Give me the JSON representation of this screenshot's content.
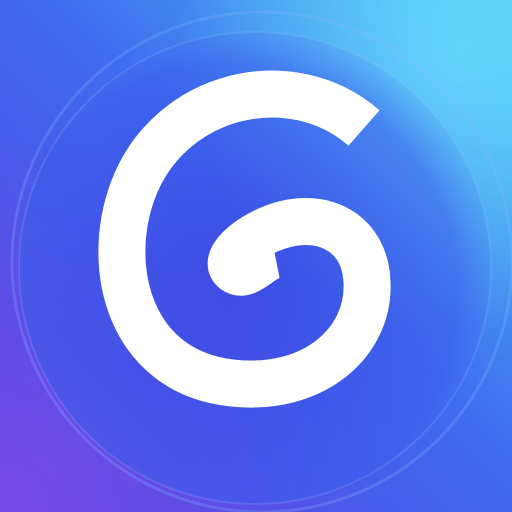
{
  "app_icon": {
    "logo_icon": "spiral-g-logo-icon",
    "colors": {
      "background_top_right": "#47c9f0",
      "background_mid": "#3f6cf0",
      "background_deep": "#4e3ee0",
      "background_edge_violet": "#7a4be8",
      "glyph": "#ffffff"
    }
  }
}
